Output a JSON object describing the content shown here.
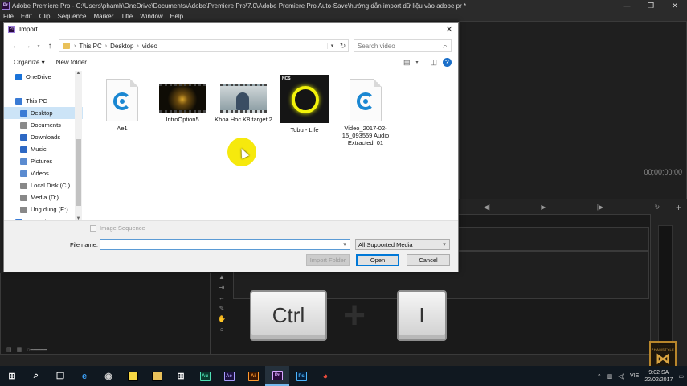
{
  "app": {
    "title": "Adobe Premiere Pro - C:\\Users\\phamh\\OneDrive\\Documents\\Adobe\\Premiere Pro\\7.0\\Adobe Premiere Pro Auto-Save\\hướng dẫn import dữ liệu vào adobe pr *",
    "logo": "Pr",
    "menu": [
      "File",
      "Edit",
      "Clip",
      "Sequence",
      "Marker",
      "Title",
      "Window",
      "Help"
    ],
    "timecode": "00;00;00;00"
  },
  "dialog": {
    "title": "Import",
    "path": [
      "This PC",
      "Desktop",
      "video"
    ],
    "search_placeholder": "Search video",
    "toolbar": {
      "organize": "Organize ▾",
      "new_folder": "New folder"
    },
    "nav": [
      {
        "label": "OneDrive",
        "color": "#1a73d9",
        "indent": 14
      },
      {
        "label": "",
        "color": "",
        "indent": 0
      },
      {
        "label": "This PC",
        "color": "#3a7bd5",
        "indent": 14
      },
      {
        "label": "Desktop",
        "color": "#3a7bd5",
        "indent": 20,
        "selected": true
      },
      {
        "label": "Documents",
        "color": "#8a8a8a",
        "indent": 20
      },
      {
        "label": "Downloads",
        "color": "#2d68c4",
        "indent": 20
      },
      {
        "label": "Music",
        "color": "#2d68c4",
        "indent": 20
      },
      {
        "label": "Pictures",
        "color": "#5b8bd0",
        "indent": 20
      },
      {
        "label": "Videos",
        "color": "#5b8bd0",
        "indent": 20
      },
      {
        "label": "Local Disk (C:)",
        "color": "#888",
        "indent": 20
      },
      {
        "label": "Media (D:)",
        "color": "#888",
        "indent": 20
      },
      {
        "label": "Ung dung (E:)",
        "color": "#888",
        "indent": 20
      },
      {
        "label": "Network",
        "color": "#3a7bd5",
        "indent": 14
      }
    ],
    "files": [
      {
        "name": "Ae1",
        "kind": "doc"
      },
      {
        "name": "IntroOption5",
        "kind": "video-intro"
      },
      {
        "name": "Khoa Hoc K8 target 2",
        "kind": "video-khoa"
      },
      {
        "name": "Tobu - Life",
        "kind": "image",
        "badge": "NCS"
      },
      {
        "name": "Video_2017-02-15_093559 Audio Extracted_01",
        "kind": "doc"
      }
    ],
    "image_sequence_label": "Image Sequence",
    "file_name_label": "File name:",
    "file_name_value": "",
    "file_type": "All Supported Media",
    "buttons": {
      "import_folder": "Import Folder",
      "open": "Open",
      "cancel": "Cancel"
    }
  },
  "keys": {
    "ctrl": "Ctrl",
    "plus": "+",
    "i": "I"
  },
  "watermark": {
    "text": "PHAMSTYLE",
    "mark": "⋈"
  },
  "taskbar": {
    "apps": [
      {
        "name": "start",
        "label": "⊞",
        "bg": "",
        "fg": "#ffffff"
      },
      {
        "name": "search",
        "label": "⌕",
        "bg": "",
        "fg": "#ffffff"
      },
      {
        "name": "task-view",
        "label": "❐",
        "bg": "",
        "fg": "#ffffff"
      },
      {
        "name": "edge",
        "label": "e",
        "bg": "",
        "fg": "#3b9cf0"
      },
      {
        "name": "photoshop-tool",
        "label": "◉",
        "bg": "",
        "fg": "#cfcfcf"
      },
      {
        "name": "sticky-notes",
        "label": "",
        "bg": "#f6d743",
        "fg": "#000"
      },
      {
        "name": "file-explorer",
        "label": "",
        "bg": "#e8c05a",
        "fg": "#000"
      },
      {
        "name": "store",
        "label": "⊞",
        "bg": "",
        "fg": "#ffffff"
      },
      {
        "name": "audition",
        "label": "Au",
        "bg": "#0a3a2e",
        "fg": "#4fe0b5"
      },
      {
        "name": "after-effects",
        "label": "Ae",
        "bg": "#1d1240",
        "fg": "#a99cff"
      },
      {
        "name": "illustrator",
        "label": "Ai",
        "bg": "#3b1500",
        "fg": "#ff9a2e"
      },
      {
        "name": "premiere",
        "label": "Pr",
        "bg": "#2a0a3d",
        "fg": "#d9a6ff",
        "active": true
      },
      {
        "name": "photoshop",
        "label": "Ps",
        "bg": "#041e3b",
        "fg": "#4cb6ff"
      },
      {
        "name": "chrome",
        "label": "◕",
        "bg": "",
        "fg": "#e84a3b"
      }
    ],
    "tray": {
      "lang": "VIE",
      "time": "9:02 SA",
      "date": "22/02/2017"
    }
  }
}
